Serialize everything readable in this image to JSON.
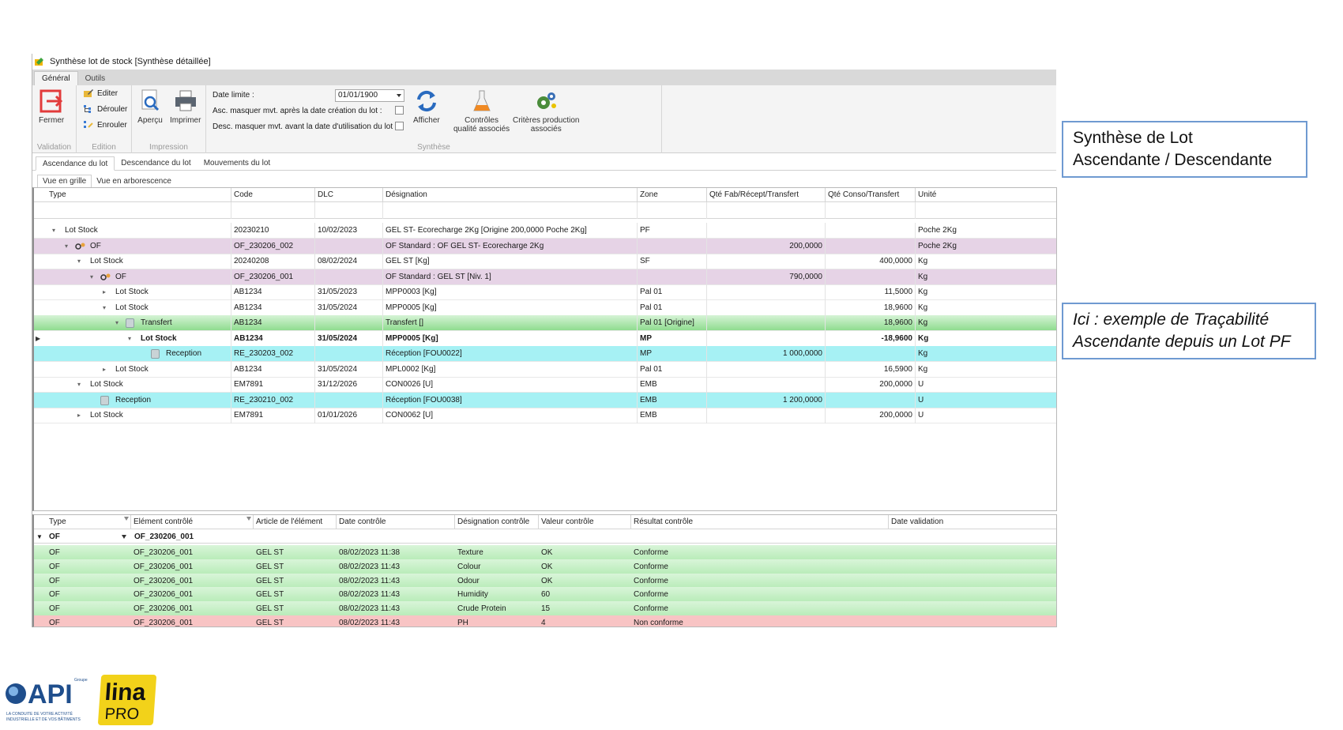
{
  "window": {
    "title": "Synthèse lot de stock [Synthèse détaillée]",
    "ribbon_tabs": [
      {
        "label": "Général",
        "active": true
      },
      {
        "label": "Outils",
        "active": false
      }
    ]
  },
  "ribbon": {
    "validation": {
      "caption": "Validation",
      "fermer": "Fermer"
    },
    "edition": {
      "caption": "Edition",
      "editer": "Editer",
      "derouler": "Dérouler",
      "enrouler": "Enrouler"
    },
    "impression": {
      "caption": "Impression",
      "apercu": "Aperçu",
      "imprimer": "Imprimer"
    },
    "synthese": {
      "caption": "Synthèse",
      "date_limite_label": "Date limite :",
      "date_limite_value": "01/01/1900",
      "asc_label": "Asc. masquer mvt. après la date création du lot :",
      "desc_label": "Desc. masquer mvt. avant la date d'utilisation du lot :",
      "afficher": "Afficher",
      "controles_l1": "Contrôles",
      "controles_l2": "qualité associés",
      "criteres_l1": "Critères production",
      "criteres_l2": "associés"
    }
  },
  "subtabs": [
    "Ascendance du lot",
    "Descendance du lot",
    "Mouvements du lot"
  ],
  "viewtabs": [
    "Vue en grille",
    "Vue en arborescence"
  ],
  "grid": {
    "columns": [
      "Type",
      "Code",
      "DLC",
      "Désignation",
      "Zone",
      "Qté Fab/Récept/Transfert",
      "Qté Conso/Transfert",
      "Unité"
    ],
    "rows": [
      {
        "type": "Lot Stock",
        "code": "20230210",
        "dlc": "10/02/2023",
        "designation": "GEL ST- Ecorecharge 2Kg [Origine 200,0000 Poche 2Kg]",
        "zone": "PF",
        "qfab": "",
        "qconso": "",
        "unite": "Poche 2Kg"
      },
      {
        "type": "OF",
        "code": "OF_230206_002",
        "dlc": "",
        "designation": "OF Standard : OF GEL ST- Ecorecharge 2Kg",
        "zone": "",
        "qfab": "200,0000",
        "qconso": "",
        "unite": "Poche 2Kg"
      },
      {
        "type": "Lot Stock",
        "code": "20240208",
        "dlc": "08/02/2024",
        "designation": "GEL ST [Kg]",
        "zone": "SF",
        "qfab": "",
        "qconso": "400,0000",
        "unite": "Kg"
      },
      {
        "type": "OF",
        "code": "OF_230206_001",
        "dlc": "",
        "designation": "OF Standard : GEL ST [Niv. 1]",
        "zone": "",
        "qfab": "790,0000",
        "qconso": "",
        "unite": "Kg"
      },
      {
        "type": "Lot Stock",
        "code": "AB1234",
        "dlc": "31/05/2023",
        "designation": "MPP0003 [Kg]",
        "zone": "Pal 01",
        "qfab": "",
        "qconso": "11,5000",
        "unite": "Kg"
      },
      {
        "type": "Lot Stock",
        "code": "AB1234",
        "dlc": "31/05/2024",
        "designation": "MPP0005 [Kg]",
        "zone": "Pal 01",
        "qfab": "",
        "qconso": "18,9600",
        "unite": "Kg"
      },
      {
        "type": "Transfert",
        "code": "AB1234",
        "dlc": "",
        "designation": "Transfert []",
        "zone": "Pal 01 [Origine]",
        "qfab": "",
        "qconso": "18,9600",
        "unite": "Kg"
      },
      {
        "type": "Lot Stock",
        "code": "AB1234",
        "dlc": "31/05/2024",
        "designation": "MPP0005 [Kg]",
        "zone": "MP",
        "qfab": "",
        "qconso": "-18,9600",
        "unite": "Kg"
      },
      {
        "type": "Reception",
        "code": "RE_230203_002",
        "dlc": "",
        "designation": "Réception [FOU0022]",
        "zone": "MP",
        "qfab": "1 000,0000",
        "qconso": "",
        "unite": "Kg"
      },
      {
        "type": "Lot Stock",
        "code": "AB1234",
        "dlc": "31/05/2024",
        "designation": "MPL0002 [Kg]",
        "zone": "Pal 01",
        "qfab": "",
        "qconso": "16,5900",
        "unite": "Kg"
      },
      {
        "type": "Lot Stock",
        "code": "EM7891",
        "dlc": "31/12/2026",
        "designation": "CON0026 [U]",
        "zone": "EMB",
        "qfab": "",
        "qconso": "200,0000",
        "unite": "U"
      },
      {
        "type": "Reception",
        "code": "RE_230210_002",
        "dlc": "",
        "designation": "Réception [FOU0038]",
        "zone": "EMB",
        "qfab": "1 200,0000",
        "qconso": "",
        "unite": "U"
      },
      {
        "type": "Lot Stock",
        "code": "EM7891",
        "dlc": "01/01/2026",
        "designation": "CON0062 [U]",
        "zone": "EMB",
        "qfab": "",
        "qconso": "200,0000",
        "unite": "U"
      }
    ]
  },
  "controls": {
    "columns": [
      "Type",
      "Elément contrôlé",
      "Article de l'élément",
      "Date contrôle",
      "Désignation contrôle",
      "Valeur contrôle",
      "Résultat contrôle",
      "Date validation"
    ],
    "filter": {
      "type": "OF",
      "element": "OF_230206_001"
    },
    "rows": [
      {
        "type": "OF",
        "element": "OF_230206_001",
        "article": "GEL ST",
        "date": "08/02/2023 11:38",
        "designation": "Texture",
        "valeur": "OK",
        "resultat": "Conforme",
        "status": "ok"
      },
      {
        "type": "OF",
        "element": "OF_230206_001",
        "article": "GEL ST",
        "date": "08/02/2023 11:43",
        "designation": "Colour",
        "valeur": "OK",
        "resultat": "Conforme",
        "status": "ok"
      },
      {
        "type": "OF",
        "element": "OF_230206_001",
        "article": "GEL ST",
        "date": "08/02/2023 11:43",
        "designation": "Odour",
        "valeur": "OK",
        "resultat": "Conforme",
        "status": "ok"
      },
      {
        "type": "OF",
        "element": "OF_230206_001",
        "article": "GEL ST",
        "date": "08/02/2023 11:43",
        "designation": "Humidity",
        "valeur": "60",
        "resultat": "Conforme",
        "status": "ok"
      },
      {
        "type": "OF",
        "element": "OF_230206_001",
        "article": "GEL ST",
        "date": "08/02/2023 11:43",
        "designation": "Crude Protein",
        "valeur": "15",
        "resultat": "Conforme",
        "status": "ok"
      },
      {
        "type": "OF",
        "element": "OF_230206_001",
        "article": "GEL ST",
        "date": "08/02/2023 11:43",
        "designation": "PH",
        "valeur": "4",
        "resultat": "Non conforme",
        "status": "nok"
      }
    ]
  },
  "callouts": {
    "synthese_l1": "Synthèse de Lot",
    "synthese_l2": "Ascendante / Descendante",
    "ici_l1": "Ici : exemple de Traçabilité",
    "ici_l2": "Ascendante depuis un Lot PF"
  },
  "logos": {
    "api_group": "Groupe",
    "api": "API",
    "api_tagline_l1": "LA CONDUITE DE VOTRE ACTIVITÉ",
    "api_tagline_l2": "INDUSTRIELLE ET DE VOS BÂTIMENTS",
    "lina": "lina",
    "pro": "PRO"
  }
}
